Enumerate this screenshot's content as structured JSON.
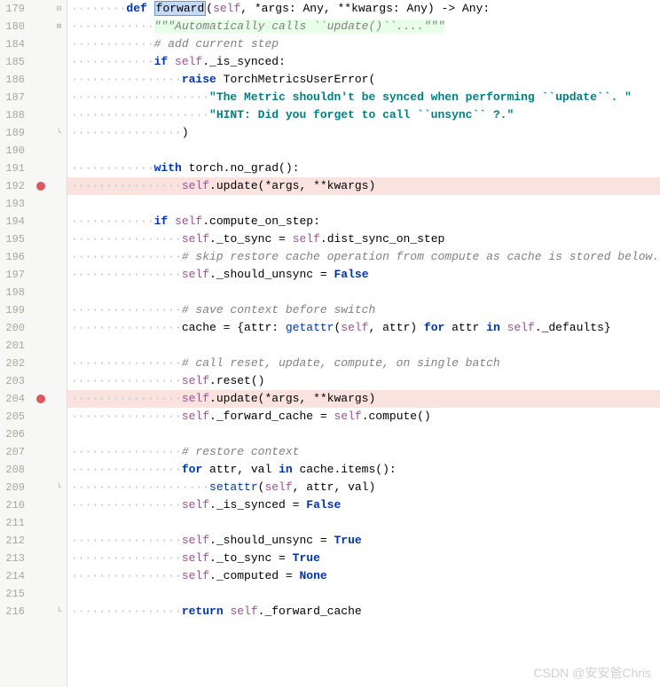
{
  "watermark": "CSDN @安安爸Chris",
  "lines": [
    {
      "num": 179,
      "fold": "minus",
      "tokens": [
        [
          "dots",
          "········"
        ],
        [
          "kw",
          "def "
        ],
        [
          "fname-hl",
          "forward"
        ],
        [
          "op",
          "("
        ],
        [
          "self",
          "self"
        ],
        [
          "op",
          ", *args: Any, **kwargs: Any) -> Any:"
        ]
      ]
    },
    {
      "num": 180,
      "fold": "plus",
      "tokens": [
        [
          "dots",
          "············"
        ],
        [
          "docstr",
          "\"\"\"Automatically calls ``update()``....\"\"\""
        ]
      ]
    },
    {
      "num": 184,
      "tokens": [
        [
          "dots",
          "············"
        ],
        [
          "comment",
          "# add current step"
        ]
      ]
    },
    {
      "num": 185,
      "tokens": [
        [
          "dots",
          "············"
        ],
        [
          "kw",
          "if "
        ],
        [
          "self",
          "self"
        ],
        [
          "op",
          "._is_synced:"
        ]
      ]
    },
    {
      "num": 186,
      "tokens": [
        [
          "dots",
          "················"
        ],
        [
          "kw",
          "raise "
        ],
        [
          "fn",
          "TorchMetricsUserError("
        ]
      ]
    },
    {
      "num": 187,
      "tokens": [
        [
          "dots",
          "····················"
        ],
        [
          "str",
          "\"The Metric shouldn't be synced when performing ``update``. \""
        ]
      ]
    },
    {
      "num": 188,
      "tokens": [
        [
          "dots",
          "····················"
        ],
        [
          "str",
          "\"HINT: Did you forget to call ``unsync`` ?.\""
        ]
      ]
    },
    {
      "num": 189,
      "fold": "end",
      "tokens": [
        [
          "dots",
          "················"
        ],
        [
          "op",
          ")"
        ]
      ]
    },
    {
      "num": 190,
      "tokens": []
    },
    {
      "num": 191,
      "tokens": [
        [
          "dots",
          "············"
        ],
        [
          "kw",
          "with "
        ],
        [
          "fn",
          "torch.no_grad():"
        ]
      ]
    },
    {
      "num": 192,
      "bp": true,
      "hl": true,
      "tokens": [
        [
          "dots",
          "················"
        ],
        [
          "self",
          "self"
        ],
        [
          "op",
          ".update(*args, **kwargs)"
        ]
      ]
    },
    {
      "num": 193,
      "tokens": []
    },
    {
      "num": 194,
      "tokens": [
        [
          "dots",
          "············"
        ],
        [
          "kw",
          "if "
        ],
        [
          "self",
          "self"
        ],
        [
          "op",
          ".compute_on_step:"
        ]
      ]
    },
    {
      "num": 195,
      "tokens": [
        [
          "dots",
          "················"
        ],
        [
          "self",
          "self"
        ],
        [
          "op",
          "._to_sync = "
        ],
        [
          "self",
          "self"
        ],
        [
          "op",
          ".dist_sync_on_step"
        ]
      ]
    },
    {
      "num": 196,
      "tokens": [
        [
          "dots",
          "················"
        ],
        [
          "comment",
          "# skip restore cache operation from compute as cache is stored below."
        ]
      ]
    },
    {
      "num": 197,
      "tokens": [
        [
          "dots",
          "················"
        ],
        [
          "self",
          "self"
        ],
        [
          "op",
          "._should_unsync = "
        ],
        [
          "kw",
          "False"
        ]
      ]
    },
    {
      "num": 198,
      "tokens": []
    },
    {
      "num": 199,
      "tokens": [
        [
          "dots",
          "················"
        ],
        [
          "comment",
          "# save context before switch"
        ]
      ]
    },
    {
      "num": 200,
      "tokens": [
        [
          "dots",
          "················"
        ],
        [
          "op",
          "cache = {attr: "
        ],
        [
          "builtin",
          "getattr"
        ],
        [
          "op",
          "("
        ],
        [
          "self",
          "self"
        ],
        [
          "op",
          ", attr) "
        ],
        [
          "kw",
          "for"
        ],
        [
          "op",
          " attr "
        ],
        [
          "kw",
          "in"
        ],
        [
          "op",
          " "
        ],
        [
          "self",
          "self"
        ],
        [
          "op",
          "._defaults}"
        ]
      ]
    },
    {
      "num": 201,
      "tokens": []
    },
    {
      "num": 202,
      "tokens": [
        [
          "dots",
          "················"
        ],
        [
          "comment",
          "# call reset, update, compute, on single batch"
        ]
      ]
    },
    {
      "num": 203,
      "tokens": [
        [
          "dots",
          "················"
        ],
        [
          "self",
          "self"
        ],
        [
          "op",
          ".reset()"
        ]
      ]
    },
    {
      "num": 204,
      "bp": true,
      "hl": true,
      "tokens": [
        [
          "dots",
          "················"
        ],
        [
          "self",
          "self"
        ],
        [
          "op",
          ".update(*args, **kwargs)"
        ]
      ]
    },
    {
      "num": 205,
      "tokens": [
        [
          "dots",
          "················"
        ],
        [
          "self",
          "self"
        ],
        [
          "op",
          "._forward_cache = "
        ],
        [
          "self",
          "self"
        ],
        [
          "op",
          ".compute()"
        ]
      ]
    },
    {
      "num": 206,
      "tokens": []
    },
    {
      "num": 207,
      "tokens": [
        [
          "dots",
          "················"
        ],
        [
          "comment",
          "# restore context"
        ]
      ]
    },
    {
      "num": 208,
      "tokens": [
        [
          "dots",
          "················"
        ],
        [
          "kw",
          "for"
        ],
        [
          "op",
          " attr, val "
        ],
        [
          "kw",
          "in"
        ],
        [
          "op",
          " cache.items():"
        ]
      ]
    },
    {
      "num": 209,
      "fold": "end",
      "tokens": [
        [
          "dots",
          "····················"
        ],
        [
          "builtin",
          "setattr"
        ],
        [
          "op",
          "("
        ],
        [
          "self",
          "self"
        ],
        [
          "op",
          ", attr, val)"
        ]
      ]
    },
    {
      "num": 210,
      "tokens": [
        [
          "dots",
          "················"
        ],
        [
          "self",
          "self"
        ],
        [
          "op",
          "._is_synced = "
        ],
        [
          "kw",
          "False"
        ]
      ]
    },
    {
      "num": 211,
      "tokens": []
    },
    {
      "num": 212,
      "tokens": [
        [
          "dots",
          "················"
        ],
        [
          "self",
          "self"
        ],
        [
          "op",
          "._should_unsync = "
        ],
        [
          "kw",
          "True"
        ]
      ]
    },
    {
      "num": 213,
      "tokens": [
        [
          "dots",
          "················"
        ],
        [
          "self",
          "self"
        ],
        [
          "op",
          "._to_sync = "
        ],
        [
          "kw",
          "True"
        ]
      ]
    },
    {
      "num": 214,
      "tokens": [
        [
          "dots",
          "················"
        ],
        [
          "self",
          "self"
        ],
        [
          "op",
          "._computed = "
        ],
        [
          "kw",
          "None"
        ]
      ]
    },
    {
      "num": 215,
      "tokens": []
    },
    {
      "num": 216,
      "fold": "end",
      "tokens": [
        [
          "dots",
          "················"
        ],
        [
          "kw",
          "return "
        ],
        [
          "self",
          "self"
        ],
        [
          "op",
          "._forward_cache"
        ]
      ]
    }
  ]
}
